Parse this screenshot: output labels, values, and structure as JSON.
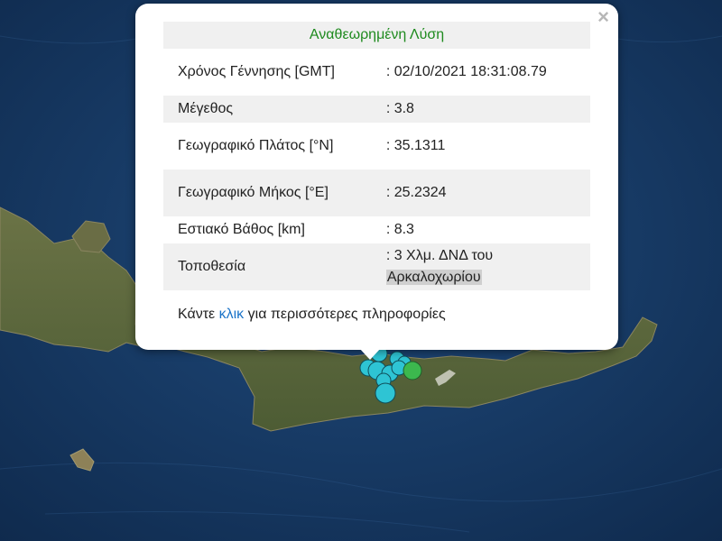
{
  "popup": {
    "close_glyph": "×",
    "title": "Αναθεωρημένη Λύση",
    "rows": [
      {
        "label": "Χρόνος Γέννησης [GMT]",
        "value": ": 02/10/2021 18:31:08.79"
      },
      {
        "label": "Μέγεθος",
        "value": ": 3.8"
      },
      {
        "label": "Γεωγραφικό Πλάτος [°N]",
        "value": ": 35.1311"
      },
      {
        "label": "Γεωγραφικό Μήκος [°E]",
        "value": ": 25.2324"
      },
      {
        "label": "Εστιακό Βάθος [km]",
        "value": ": 8.3"
      },
      {
        "label": "Τοποθεσία",
        "value_prefix": ": 3 Χλμ. ΔΝΔ του",
        "value_highlight": "Αρκαλοχωρίου"
      }
    ],
    "footer_before": "Κάντε ",
    "footer_link": "κλικ",
    "footer_after": " για περισσότερες πληροφορίες"
  },
  "map": {
    "sea_color": "#173a66",
    "land_color": "#5b6a3c",
    "marker_cyan": "#2ec4d4",
    "marker_green": "#3cb84e"
  }
}
